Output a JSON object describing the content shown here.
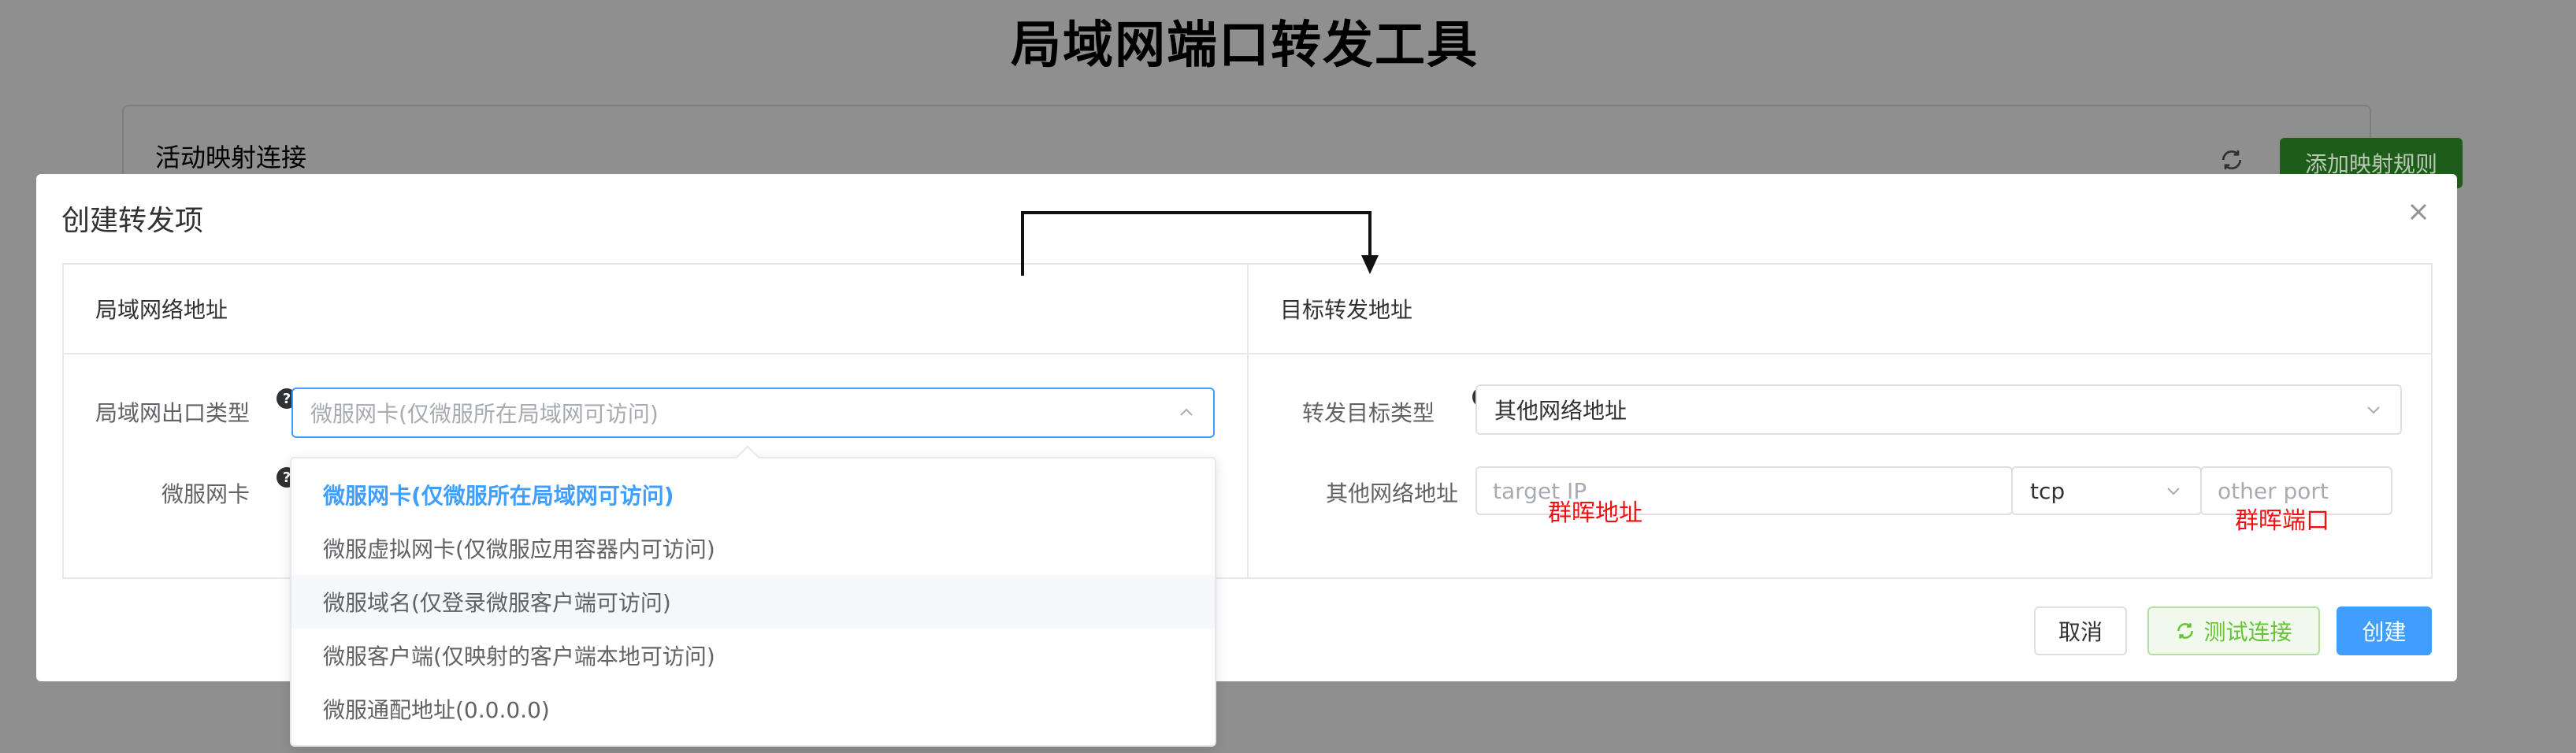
{
  "page": {
    "title": "局域网端口转发工具"
  },
  "panel": {
    "title": "活动映射连接",
    "add_button": "添加映射规则",
    "refresh_icon": "refresh-icon"
  },
  "dialog": {
    "title": "创建转发项",
    "close_icon": "close-icon",
    "left_card": {
      "header": "局域网络地址",
      "exit_type_label": "局域网出口类型",
      "exit_type_placeholder": "微服网卡(仅微服所在局域网可访问)",
      "nic_label": "微服网卡",
      "help_glyph": "?"
    },
    "right_card": {
      "header": "目标转发地址",
      "target_type_label": "转发目标类型",
      "target_type_value": "其他网络地址",
      "other_addr_label": "其他网络地址",
      "target_ip_placeholder": "target IP",
      "protocol_value": "tcp",
      "port_placeholder": "other port",
      "help_glyph": "?"
    },
    "annotations": {
      "ip_note": "群晖地址",
      "port_note": "群晖端口"
    },
    "buttons": {
      "cancel": "取消",
      "test": "测试连接",
      "create": "创建"
    }
  },
  "dropdown": {
    "options": [
      "微服网卡(仅微服所在局域网可访问)",
      "微服虚拟网卡(仅微服应用容器内可访问)",
      "微服域名(仅登录微服客户端可访问)",
      "微服客户端(仅映射的客户端本地可访问)",
      "微服通配地址(0.0.0.0)"
    ],
    "selected_index": 0,
    "hover_index": 2
  },
  "colors": {
    "primary": "#409eff",
    "success": "#67c23a",
    "annotation_red": "#ee1111",
    "overlay": "#8f8f8f"
  }
}
